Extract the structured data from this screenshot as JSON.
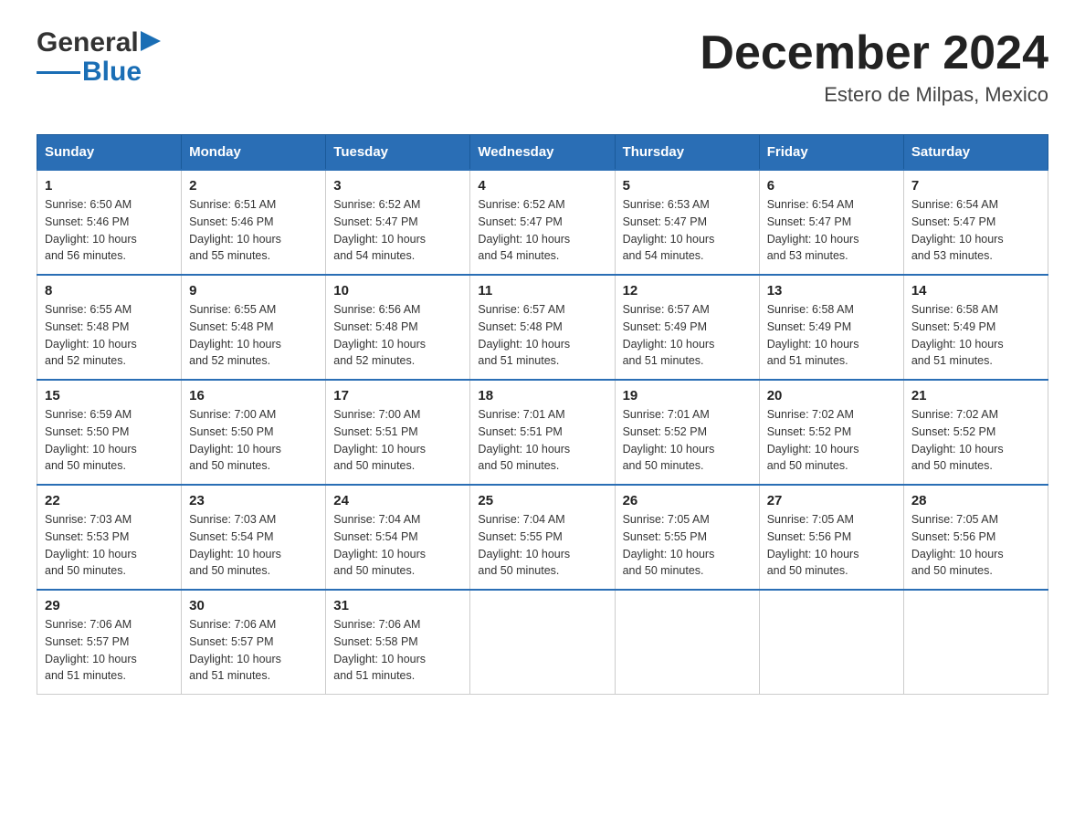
{
  "header": {
    "logo_general": "General",
    "logo_blue": "Blue",
    "month_title": "December 2024",
    "location": "Estero de Milpas, Mexico"
  },
  "days_of_week": [
    "Sunday",
    "Monday",
    "Tuesday",
    "Wednesday",
    "Thursday",
    "Friday",
    "Saturday"
  ],
  "weeks": [
    [
      {
        "day": "1",
        "sunrise": "6:50 AM",
        "sunset": "5:46 PM",
        "daylight": "10 hours and 56 minutes."
      },
      {
        "day": "2",
        "sunrise": "6:51 AM",
        "sunset": "5:46 PM",
        "daylight": "10 hours and 55 minutes."
      },
      {
        "day": "3",
        "sunrise": "6:52 AM",
        "sunset": "5:47 PM",
        "daylight": "10 hours and 54 minutes."
      },
      {
        "day": "4",
        "sunrise": "6:52 AM",
        "sunset": "5:47 PM",
        "daylight": "10 hours and 54 minutes."
      },
      {
        "day": "5",
        "sunrise": "6:53 AM",
        "sunset": "5:47 PM",
        "daylight": "10 hours and 54 minutes."
      },
      {
        "day": "6",
        "sunrise": "6:54 AM",
        "sunset": "5:47 PM",
        "daylight": "10 hours and 53 minutes."
      },
      {
        "day": "7",
        "sunrise": "6:54 AM",
        "sunset": "5:47 PM",
        "daylight": "10 hours and 53 minutes."
      }
    ],
    [
      {
        "day": "8",
        "sunrise": "6:55 AM",
        "sunset": "5:48 PM",
        "daylight": "10 hours and 52 minutes."
      },
      {
        "day": "9",
        "sunrise": "6:55 AM",
        "sunset": "5:48 PM",
        "daylight": "10 hours and 52 minutes."
      },
      {
        "day": "10",
        "sunrise": "6:56 AM",
        "sunset": "5:48 PM",
        "daylight": "10 hours and 52 minutes."
      },
      {
        "day": "11",
        "sunrise": "6:57 AM",
        "sunset": "5:48 PM",
        "daylight": "10 hours and 51 minutes."
      },
      {
        "day": "12",
        "sunrise": "6:57 AM",
        "sunset": "5:49 PM",
        "daylight": "10 hours and 51 minutes."
      },
      {
        "day": "13",
        "sunrise": "6:58 AM",
        "sunset": "5:49 PM",
        "daylight": "10 hours and 51 minutes."
      },
      {
        "day": "14",
        "sunrise": "6:58 AM",
        "sunset": "5:49 PM",
        "daylight": "10 hours and 51 minutes."
      }
    ],
    [
      {
        "day": "15",
        "sunrise": "6:59 AM",
        "sunset": "5:50 PM",
        "daylight": "10 hours and 50 minutes."
      },
      {
        "day": "16",
        "sunrise": "7:00 AM",
        "sunset": "5:50 PM",
        "daylight": "10 hours and 50 minutes."
      },
      {
        "day": "17",
        "sunrise": "7:00 AM",
        "sunset": "5:51 PM",
        "daylight": "10 hours and 50 minutes."
      },
      {
        "day": "18",
        "sunrise": "7:01 AM",
        "sunset": "5:51 PM",
        "daylight": "10 hours and 50 minutes."
      },
      {
        "day": "19",
        "sunrise": "7:01 AM",
        "sunset": "5:52 PM",
        "daylight": "10 hours and 50 minutes."
      },
      {
        "day": "20",
        "sunrise": "7:02 AM",
        "sunset": "5:52 PM",
        "daylight": "10 hours and 50 minutes."
      },
      {
        "day": "21",
        "sunrise": "7:02 AM",
        "sunset": "5:52 PM",
        "daylight": "10 hours and 50 minutes."
      }
    ],
    [
      {
        "day": "22",
        "sunrise": "7:03 AM",
        "sunset": "5:53 PM",
        "daylight": "10 hours and 50 minutes."
      },
      {
        "day": "23",
        "sunrise": "7:03 AM",
        "sunset": "5:54 PM",
        "daylight": "10 hours and 50 minutes."
      },
      {
        "day": "24",
        "sunrise": "7:04 AM",
        "sunset": "5:54 PM",
        "daylight": "10 hours and 50 minutes."
      },
      {
        "day": "25",
        "sunrise": "7:04 AM",
        "sunset": "5:55 PM",
        "daylight": "10 hours and 50 minutes."
      },
      {
        "day": "26",
        "sunrise": "7:05 AM",
        "sunset": "5:55 PM",
        "daylight": "10 hours and 50 minutes."
      },
      {
        "day": "27",
        "sunrise": "7:05 AM",
        "sunset": "5:56 PM",
        "daylight": "10 hours and 50 minutes."
      },
      {
        "day": "28",
        "sunrise": "7:05 AM",
        "sunset": "5:56 PM",
        "daylight": "10 hours and 50 minutes."
      }
    ],
    [
      {
        "day": "29",
        "sunrise": "7:06 AM",
        "sunset": "5:57 PM",
        "daylight": "10 hours and 51 minutes."
      },
      {
        "day": "30",
        "sunrise": "7:06 AM",
        "sunset": "5:57 PM",
        "daylight": "10 hours and 51 minutes."
      },
      {
        "day": "31",
        "sunrise": "7:06 AM",
        "sunset": "5:58 PM",
        "daylight": "10 hours and 51 minutes."
      },
      null,
      null,
      null,
      null
    ]
  ],
  "labels": {
    "sunrise": "Sunrise:",
    "sunset": "Sunset:",
    "daylight": "Daylight:"
  }
}
